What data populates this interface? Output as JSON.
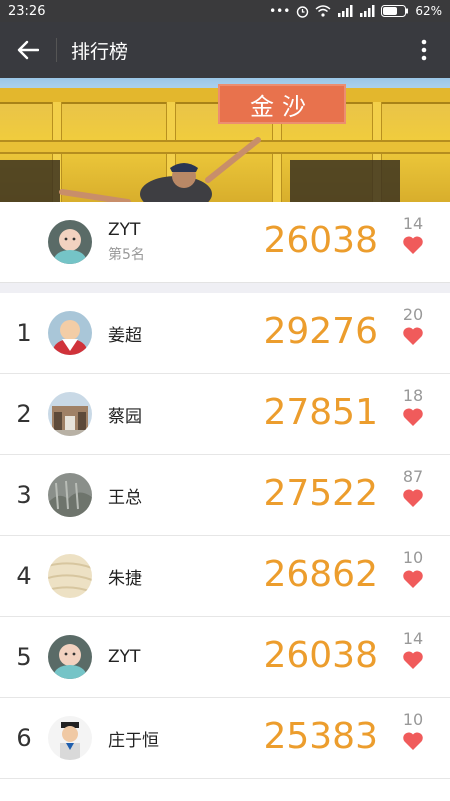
{
  "status_bar": {
    "time": "23:26",
    "icons": "•••",
    "battery": "62%"
  },
  "header": {
    "title": "排行榜"
  },
  "banner": {
    "sign_text": "金沙"
  },
  "me": {
    "name": "ZYT",
    "rank_text": "第5名",
    "steps": "26038",
    "likes": "14"
  },
  "ranking": [
    {
      "rank": "1",
      "name": "姜超",
      "steps": "29276",
      "likes": "20"
    },
    {
      "rank": "2",
      "name": "蔡园",
      "steps": "27851",
      "likes": "18"
    },
    {
      "rank": "3",
      "name": "王总",
      "steps": "27522",
      "likes": "87"
    },
    {
      "rank": "4",
      "name": "朱捷",
      "steps": "26862",
      "likes": "10"
    },
    {
      "rank": "5",
      "name": "ZYT",
      "steps": "26038",
      "likes": "14"
    },
    {
      "rank": "6",
      "name": "庄于恒",
      "steps": "25383",
      "likes": "10"
    }
  ],
  "colors": {
    "accent": "#ec9d2d",
    "heart": "#f05b5b",
    "header_bg": "#393a3f"
  }
}
